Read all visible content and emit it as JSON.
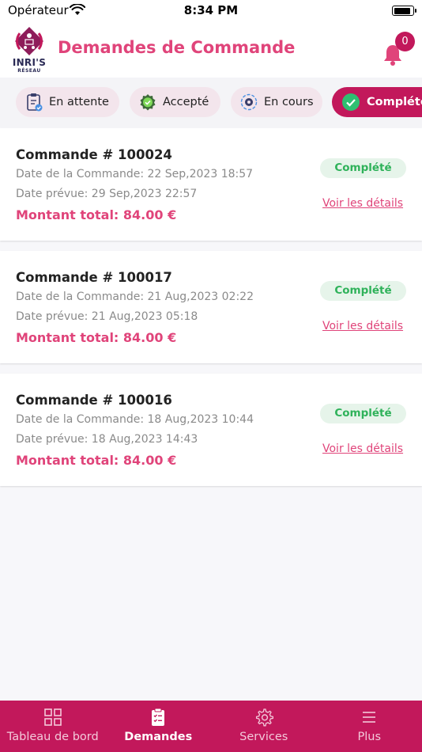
{
  "status_bar": {
    "carrier": "Opérateur",
    "time": "8:34 PM",
    "battery_level": 0.95
  },
  "header": {
    "logo_text": "INRI'S",
    "logo_subtext": "RÉSEAU",
    "title": "Demandes de Commande",
    "notification_count": "0",
    "icon": "bell-icon"
  },
  "colors": {
    "brand": "#c2185b",
    "accent": "#e0447a",
    "status_complete": "#2fb25a"
  },
  "filters": [
    {
      "label": "En attente",
      "icon": "clipboard-check-icon",
      "active": false
    },
    {
      "label": "Accepté",
      "icon": "approved-badge-icon",
      "active": false
    },
    {
      "label": "En cours",
      "icon": "gear-progress-icon",
      "active": false
    },
    {
      "label": "Complété",
      "icon": "check-circle-icon",
      "active": true
    }
  ],
  "orders": [
    {
      "number": "Commande # 100024",
      "order_date": "Date de la Commande:  22 Sep,2023 18:57",
      "expected_date": "Date prévue: 29 Sep,2023 22:57",
      "total": "Montant total: 84.00 €",
      "status": "Complété",
      "details_link": "Voir les détails"
    },
    {
      "number": "Commande # 100017",
      "order_date": "Date de la Commande:  21 Aug,2023 02:22",
      "expected_date": "Date prévue: 21 Aug,2023 05:18",
      "total": "Montant total: 84.00 €",
      "status": "Complété",
      "details_link": "Voir les détails"
    },
    {
      "number": "Commande # 100016",
      "order_date": "Date de la Commande:  18 Aug,2023 10:44",
      "expected_date": "Date prévue: 18 Aug,2023 14:43",
      "total": "Montant total: 84.00 €",
      "status": "Complété",
      "details_link": "Voir les détails"
    }
  ],
  "bottom_nav": [
    {
      "label": "Tableau de bord",
      "icon": "dashboard-grid-icon",
      "active": false
    },
    {
      "label": "Demandes",
      "icon": "clipboard-list-icon",
      "active": true
    },
    {
      "label": "Services",
      "icon": "gear-icon",
      "active": false
    },
    {
      "label": "Plus",
      "icon": "menu-icon",
      "active": false
    }
  ]
}
